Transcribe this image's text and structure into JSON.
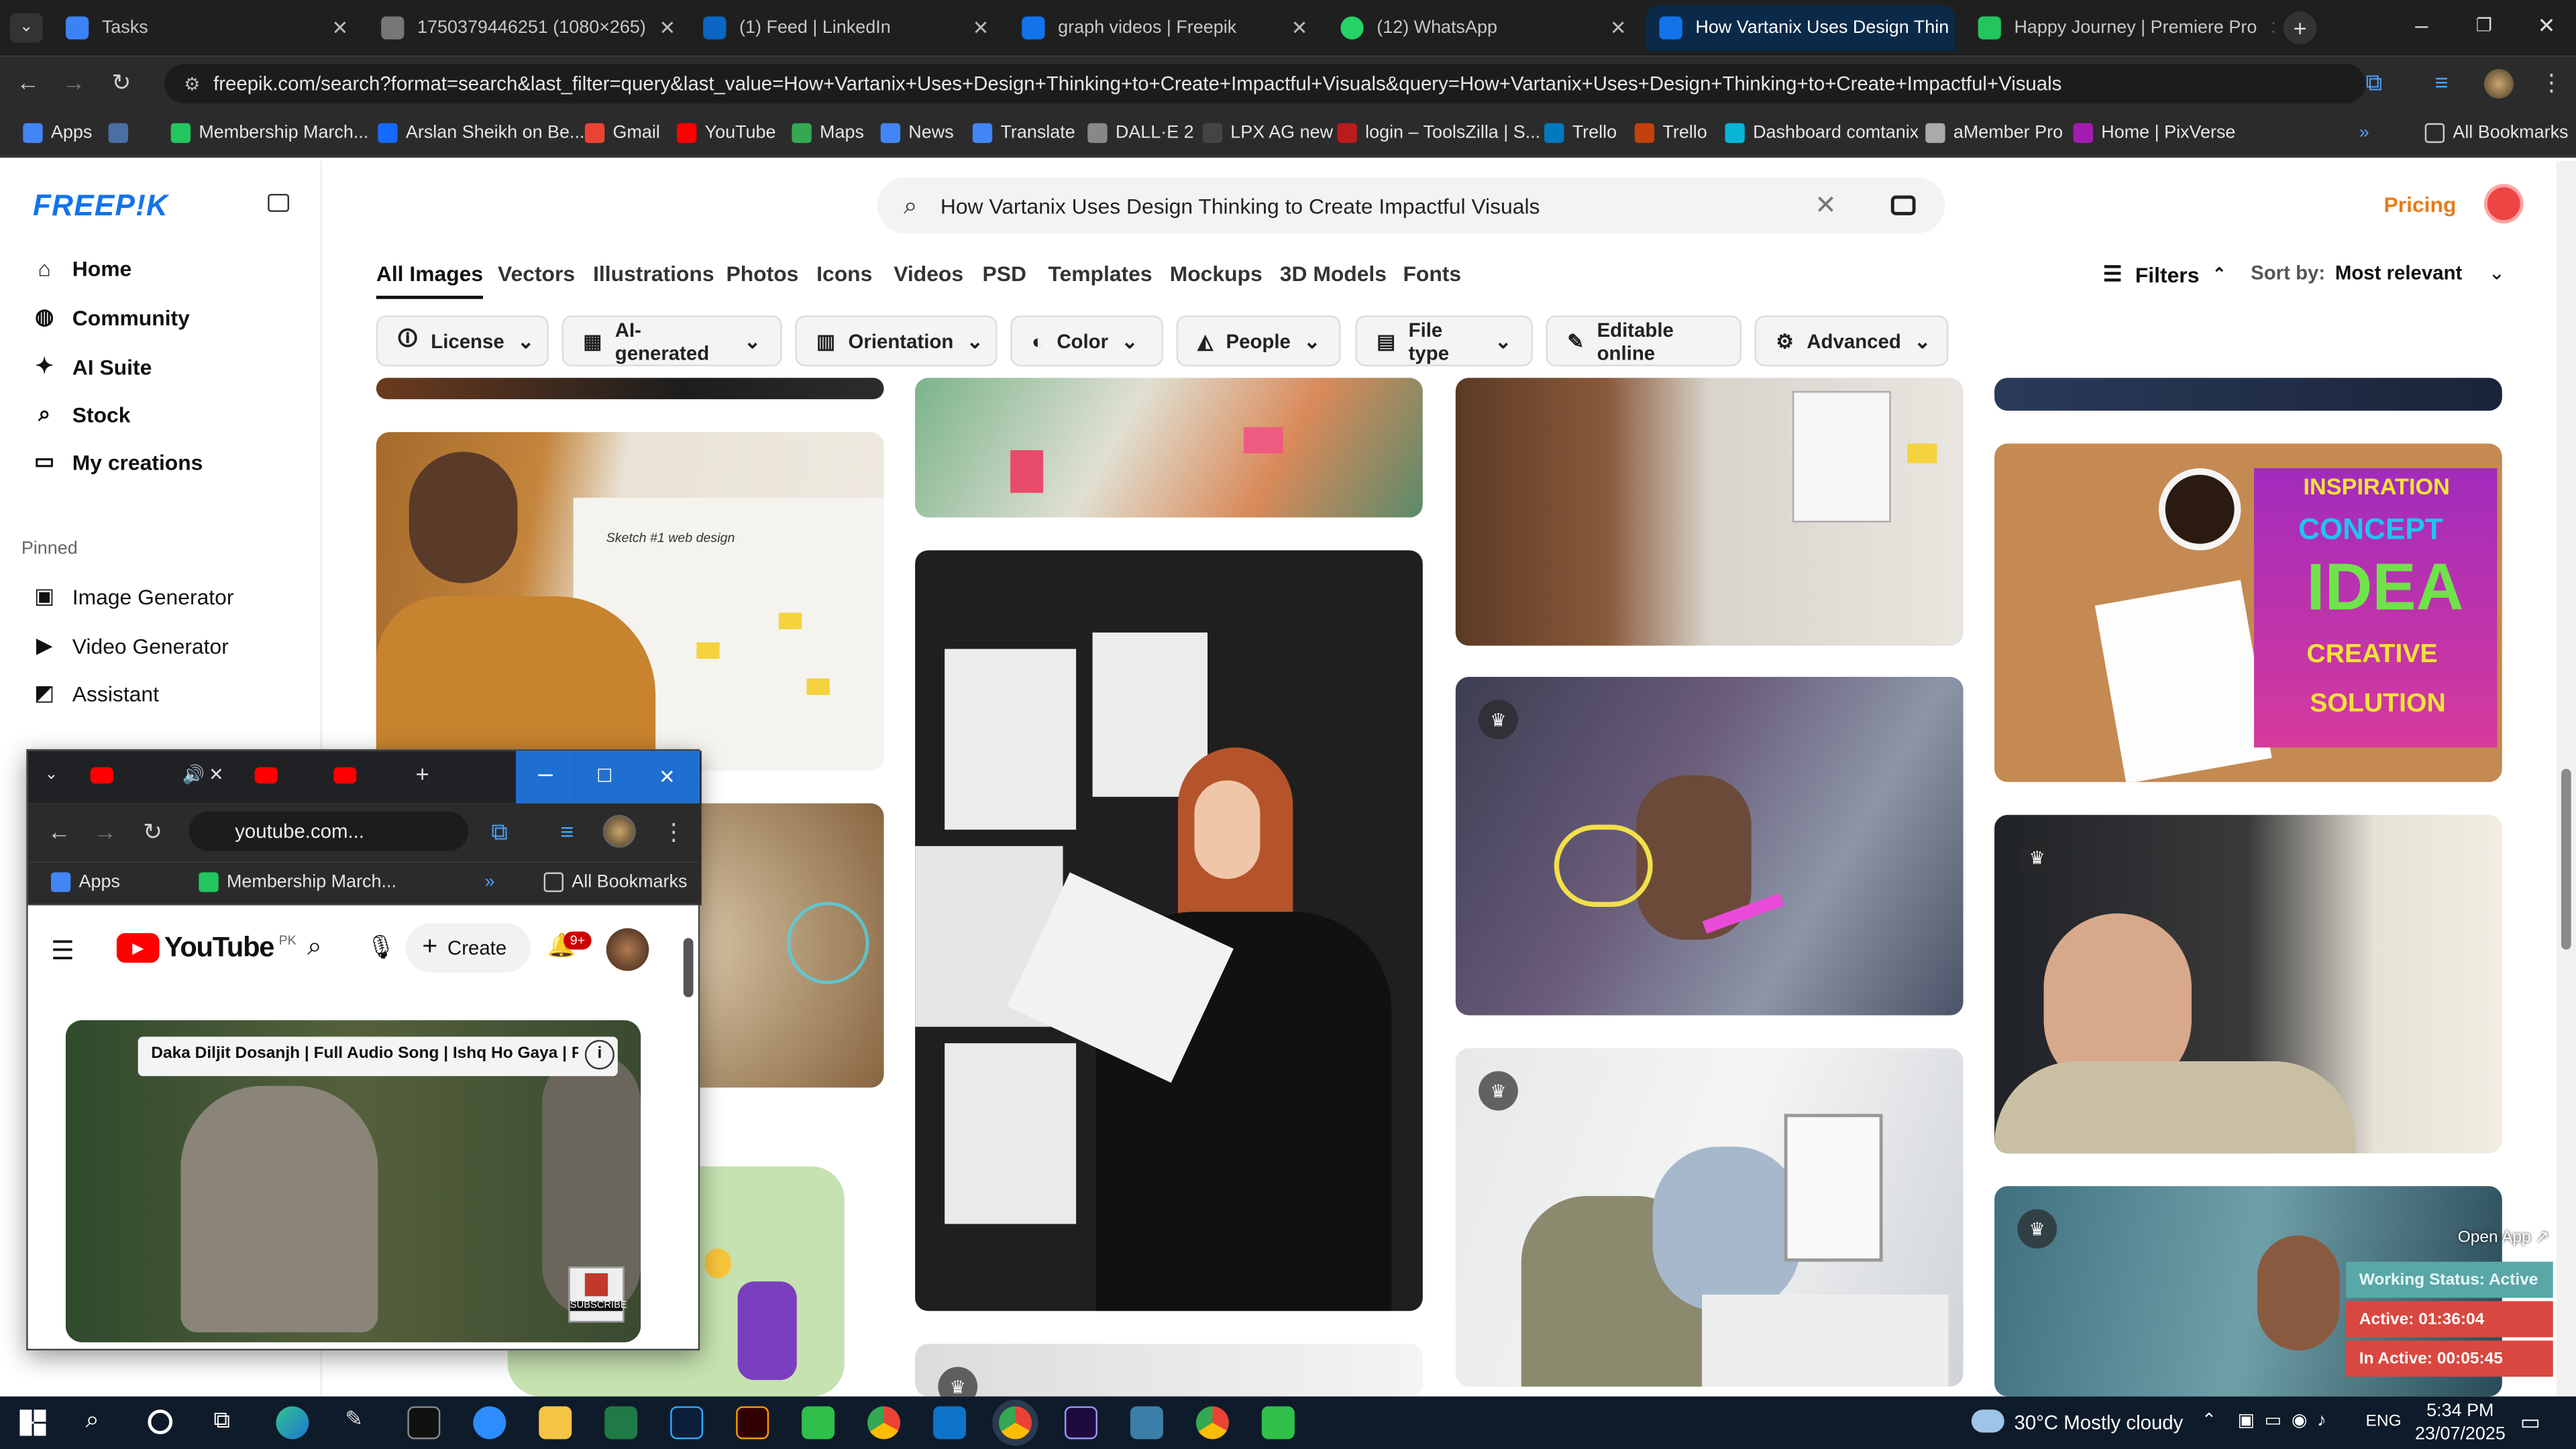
{
  "browser": {
    "tabs": [
      {
        "title": "Tasks",
        "color": "#3b82f6"
      },
      {
        "title": "1750379446251 (1080×265)",
        "color": "#777777"
      },
      {
        "title": "(1) Feed | LinkedIn",
        "color": "#0a66c2"
      },
      {
        "title": "graph videos | Freepik",
        "color": "#1273eb"
      },
      {
        "title": "(12) WhatsApp",
        "color": "#25d366"
      },
      {
        "title": "How Vartanix Uses Design Thin",
        "color": "#1273eb"
      },
      {
        "title": "Happy Journey | Premiere Pro",
        "color": "#22c55e"
      }
    ],
    "url": "freepik.com/search?format=search&last_filter=query&last_value=How+Vartanix+Uses+Design+Thinking+to+Create+Impactful+Visuals&query=How+Vartanix+Uses+Design+Thinking+to+Create+Impactful+Visuals",
    "bookmarks": [
      "Apps",
      "Membership March...",
      "Arslan Sheikh on Be...",
      "Gmail",
      "YouTube",
      "Maps",
      "News",
      "Translate",
      "DALL·E 2",
      "LPX AG new",
      "login – ToolsZilla | S...",
      "Trello",
      "Trello",
      "Dashboard comtanix",
      "aMember Pro",
      "Home | PixVerse"
    ],
    "all_bookmarks": "All Bookmarks"
  },
  "freepik": {
    "logo": "FREEP!K",
    "nav": [
      "Home",
      "Community",
      "AI Suite",
      "Stock",
      "My creations"
    ],
    "pinned_label": "Pinned",
    "pinned": [
      "Image Generator",
      "Video Generator",
      "Assistant"
    ],
    "search_value": "How Vartanix Uses Design Thinking to Create Impactful Visuals",
    "pricing": "Pricing",
    "tabs": [
      "All Images",
      "Vectors",
      "Illustrations",
      "Photos",
      "Icons",
      "Videos",
      "PSD",
      "Templates",
      "Mockups",
      "3D Models",
      "Fonts"
    ],
    "filters_label": "Filters",
    "sort_label": "Sort by:",
    "sort_value": "Most relevant",
    "filters": [
      "License",
      "AI-generated",
      "Orientation",
      "Color",
      "People",
      "File type",
      "Editable online",
      "Advanced"
    ]
  },
  "images": {
    "concept_words": [
      "INSPIRATION",
      "CONCEPT",
      "IDEA",
      "CREATIVE",
      "SOLUTION"
    ],
    "sketch_text": "Sketch #1 web design"
  },
  "youtube_window": {
    "url": "youtube.com...",
    "bookmarks": [
      "Apps",
      "Membership March...",
      "All Bookmarks"
    ],
    "logo": "YouTube",
    "region": "PK",
    "create": "Create",
    "notifications": "9+",
    "video_title": "Daka Diljit Dosanjh | Full Audio Song | Ishq Ho Gaya | Punj...",
    "subscribe": "SUBSCRIBE"
  },
  "tracker": {
    "open_app": "Open App ↗",
    "working": "Working Status: Active",
    "active": "Active: 01:36:04",
    "inactive": "In Active: 00:05:45"
  },
  "taskbar": {
    "weather": "30°C  Mostly cloudy",
    "lang": "ENG",
    "time": "5:34 PM",
    "date": "23/07/2025"
  }
}
